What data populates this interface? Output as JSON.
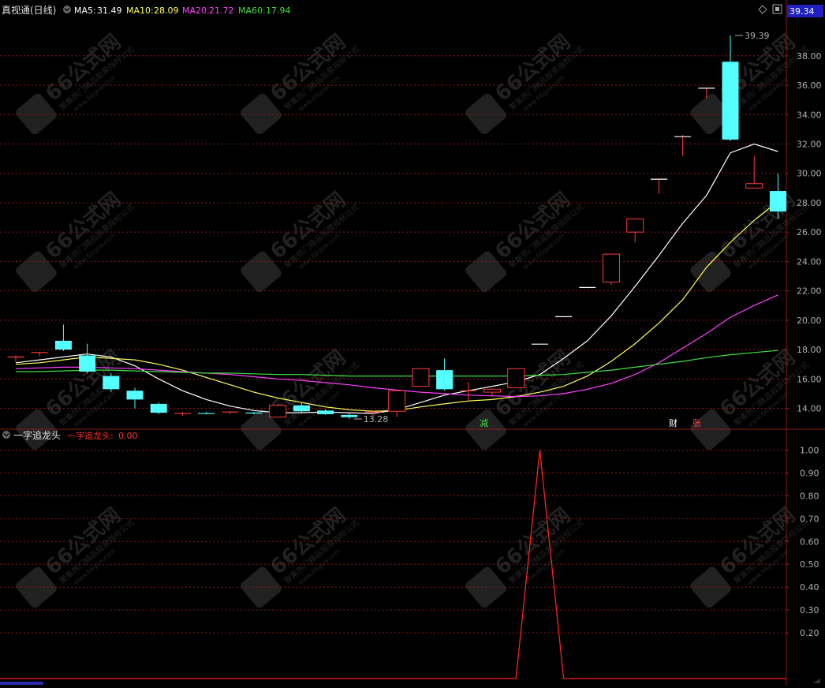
{
  "colors": {
    "background": "#000000",
    "grid": "#8b1a1a",
    "up_candle": "#ff3b3b",
    "down_candle": "#54ffff",
    "ma5": "#ffffff",
    "ma10": "#ffff5a",
    "ma20": "#ff40ff",
    "ma60": "#40e040",
    "indicator_line": "#ff2020",
    "axis_text": "#b0b0b0",
    "last_price_box": "#2020c0"
  },
  "header": {
    "title": "真视通(日线)",
    "ma5_label": "MA5:",
    "ma5_value": "31.49",
    "ma10_label": "MA10:",
    "ma10_value": "28.09",
    "ma20_label": "MA20:",
    "ma20_value": "21.72",
    "ma60_label": "MA60:",
    "ma60_value": "17.94",
    "last_price": "39.34"
  },
  "indicator_header": {
    "title": "一字追龙头",
    "series_label": "一字追龙头:",
    "series_value": "0.00"
  },
  "markers": {
    "jian": "减",
    "cai": "财",
    "zhang": "张"
  },
  "watermark": {
    "brand": "66公式网",
    "tagline": "聚集热门精品股票指标公式",
    "url": "www.66gsw.com"
  },
  "chart_data": [
    {
      "type": "candlestick",
      "title": "真视通(日线)",
      "ylim": [
        12.9,
        40.3
      ],
      "yticks": [
        14.0,
        16.0,
        18.0,
        20.0,
        22.0,
        24.0,
        26.0,
        28.0,
        30.0,
        32.0,
        34.0,
        36.0,
        38.0
      ],
      "ytick_labels": [
        "14.00",
        "16.00",
        "18.00",
        "20.00",
        "22.00",
        "24.00",
        "26.00",
        "28.00",
        "30.00",
        "32.00",
        "34.00",
        "36.00",
        "38.00"
      ],
      "annotations": [
        {
          "label": "39.39",
          "value": 39.39,
          "candle_index": 30
        },
        {
          "label": "13.28",
          "value": 13.28,
          "candle_index": 14
        }
      ],
      "candles": [
        {
          "o": 17.4,
          "h": 17.6,
          "l": 17.15,
          "c": 17.5,
          "d": "up"
        },
        {
          "o": 17.7,
          "h": 17.85,
          "l": 17.55,
          "c": 17.8,
          "d": "up"
        },
        {
          "o": 18.6,
          "h": 19.7,
          "l": 17.9,
          "c": 18.0,
          "d": "down"
        },
        {
          "o": 17.6,
          "h": 18.4,
          "l": 16.4,
          "c": 16.5,
          "d": "down"
        },
        {
          "o": 16.2,
          "h": 16.4,
          "l": 15.1,
          "c": 15.3,
          "d": "down"
        },
        {
          "o": 15.2,
          "h": 15.4,
          "l": 14.0,
          "c": 14.6,
          "d": "down"
        },
        {
          "o": 14.3,
          "h": 14.4,
          "l": 13.6,
          "c": 13.7,
          "d": "down"
        },
        {
          "o": 13.6,
          "h": 13.75,
          "l": 13.5,
          "c": 13.65,
          "d": "up"
        },
        {
          "o": 13.7,
          "h": 13.75,
          "l": 13.6,
          "c": 13.65,
          "d": "down"
        },
        {
          "o": 13.65,
          "h": 13.8,
          "l": 13.6,
          "c": 13.75,
          "d": "up"
        },
        {
          "o": 13.7,
          "h": 13.75,
          "l": 13.6,
          "c": 13.68,
          "d": "down"
        },
        {
          "o": 13.4,
          "h": 14.3,
          "l": 13.4,
          "c": 14.2,
          "d": "up"
        },
        {
          "o": 14.2,
          "h": 14.35,
          "l": 13.7,
          "c": 13.8,
          "d": "down"
        },
        {
          "o": 13.85,
          "h": 13.95,
          "l": 13.55,
          "c": 13.6,
          "d": "down"
        },
        {
          "o": 13.55,
          "h": 13.65,
          "l": 13.28,
          "c": 13.4,
          "d": "down"
        },
        {
          "o": 13.7,
          "h": 13.8,
          "l": 13.5,
          "c": 13.75,
          "d": "up"
        },
        {
          "o": 13.8,
          "h": 15.2,
          "l": 13.4,
          "c": 15.2,
          "d": "up"
        },
        {
          "o": 15.5,
          "h": 16.7,
          "l": 15.5,
          "c": 16.7,
          "d": "up"
        },
        {
          "o": 16.6,
          "h": 17.4,
          "l": 15.2,
          "c": 15.3,
          "d": "down"
        },
        {
          "o": 15.1,
          "h": 15.8,
          "l": 14.5,
          "c": 15.2,
          "d": "up"
        },
        {
          "o": 15.1,
          "h": 15.35,
          "l": 14.8,
          "c": 15.3,
          "d": "up"
        },
        {
          "o": 15.4,
          "h": 16.7,
          "l": 15.4,
          "c": 16.7,
          "d": "up"
        },
        {
          "o": 18.37,
          "h": 18.37,
          "l": 18.37,
          "c": 18.37,
          "d": "up",
          "one_word": true
        },
        {
          "o": 20.24,
          "h": 20.24,
          "l": 20.24,
          "c": 20.24,
          "d": "up",
          "one_word": true
        },
        {
          "o": 22.23,
          "h": 22.23,
          "l": 22.23,
          "c": 22.23,
          "d": "up",
          "one_word": true
        },
        {
          "o": 22.6,
          "h": 24.5,
          "l": 22.4,
          "c": 24.5,
          "d": "up"
        },
        {
          "o": 26.0,
          "h": 26.9,
          "l": 25.3,
          "c": 26.9,
          "d": "up"
        },
        {
          "o": 29.6,
          "h": 29.6,
          "l": 28.6,
          "c": 29.6,
          "d": "up",
          "one_word": true
        },
        {
          "o": 32.5,
          "h": 32.6,
          "l": 31.2,
          "c": 32.5,
          "d": "up",
          "one_word": true
        },
        {
          "o": 35.8,
          "h": 35.8,
          "l": 35.1,
          "c": 35.8,
          "d": "up",
          "one_word": true
        },
        {
          "o": 37.6,
          "h": 39.39,
          "l": 32.2,
          "c": 32.3,
          "d": "down"
        },
        {
          "o": 29.0,
          "h": 31.2,
          "l": 29.0,
          "c": 29.3,
          "d": "up"
        },
        {
          "o": 28.8,
          "h": 30.0,
          "l": 26.9,
          "c": 27.4,
          "d": "down"
        }
      ],
      "series": [
        {
          "name": "MA5",
          "values": [
            17.1,
            17.3,
            17.5,
            17.7,
            17.5,
            16.9,
            16.0,
            15.2,
            14.6,
            14.15,
            13.85,
            13.7,
            13.7,
            13.75,
            13.7,
            13.65,
            13.9,
            14.4,
            14.9,
            15.2,
            15.5,
            15.8,
            16.3,
            17.4,
            18.6,
            20.3,
            22.3,
            24.4,
            26.6,
            28.5,
            31.4,
            32.0,
            31.49
          ]
        },
        {
          "name": "MA10",
          "values": [
            17.0,
            17.1,
            17.3,
            17.5,
            17.4,
            17.3,
            17.0,
            16.6,
            16.1,
            15.6,
            15.1,
            14.7,
            14.4,
            14.1,
            13.9,
            13.8,
            13.85,
            14.1,
            14.3,
            14.5,
            14.6,
            14.8,
            15.1,
            15.5,
            16.2,
            17.2,
            18.4,
            19.8,
            21.4,
            23.6,
            25.3,
            26.8,
            28.09
          ]
        },
        {
          "name": "MA20",
          "values": [
            16.7,
            16.75,
            16.8,
            16.8,
            16.75,
            16.7,
            16.6,
            16.5,
            16.4,
            16.3,
            16.15,
            16.0,
            15.9,
            15.75,
            15.6,
            15.4,
            15.25,
            15.1,
            15.0,
            14.9,
            14.85,
            14.8,
            14.85,
            15.0,
            15.3,
            15.7,
            16.3,
            17.1,
            18.1,
            19.1,
            20.2,
            21.0,
            21.72
          ]
        },
        {
          "name": "MA60",
          "values": [
            16.5,
            16.5,
            16.55,
            16.6,
            16.6,
            16.55,
            16.5,
            16.45,
            16.4,
            16.4,
            16.35,
            16.3,
            16.3,
            16.25,
            16.2,
            16.2,
            16.2,
            16.2,
            16.2,
            16.2,
            16.2,
            16.2,
            16.25,
            16.3,
            16.45,
            16.6,
            16.8,
            17.0,
            17.2,
            17.45,
            17.65,
            17.8,
            17.94
          ]
        }
      ]
    },
    {
      "type": "line",
      "title": "一字追龙头",
      "ylim": [
        0,
        1.05
      ],
      "yticks": [
        0.2,
        0.3,
        0.4,
        0.5,
        0.6,
        0.7,
        0.8,
        0.9,
        1.0
      ],
      "ytick_labels": [
        "0.20",
        "0.30",
        "0.40",
        "0.50",
        "0.60",
        "0.70",
        "0.80",
        "0.90",
        "1.00"
      ],
      "series": [
        {
          "name": "一字追龙头",
          "values": [
            0,
            0,
            0,
            0,
            0,
            0,
            0,
            0,
            0,
            0,
            0,
            0,
            0,
            0,
            0,
            0,
            0,
            0,
            0,
            0,
            0,
            0,
            1,
            0,
            0,
            0,
            0,
            0,
            0,
            0,
            0,
            0,
            0
          ]
        }
      ]
    }
  ]
}
